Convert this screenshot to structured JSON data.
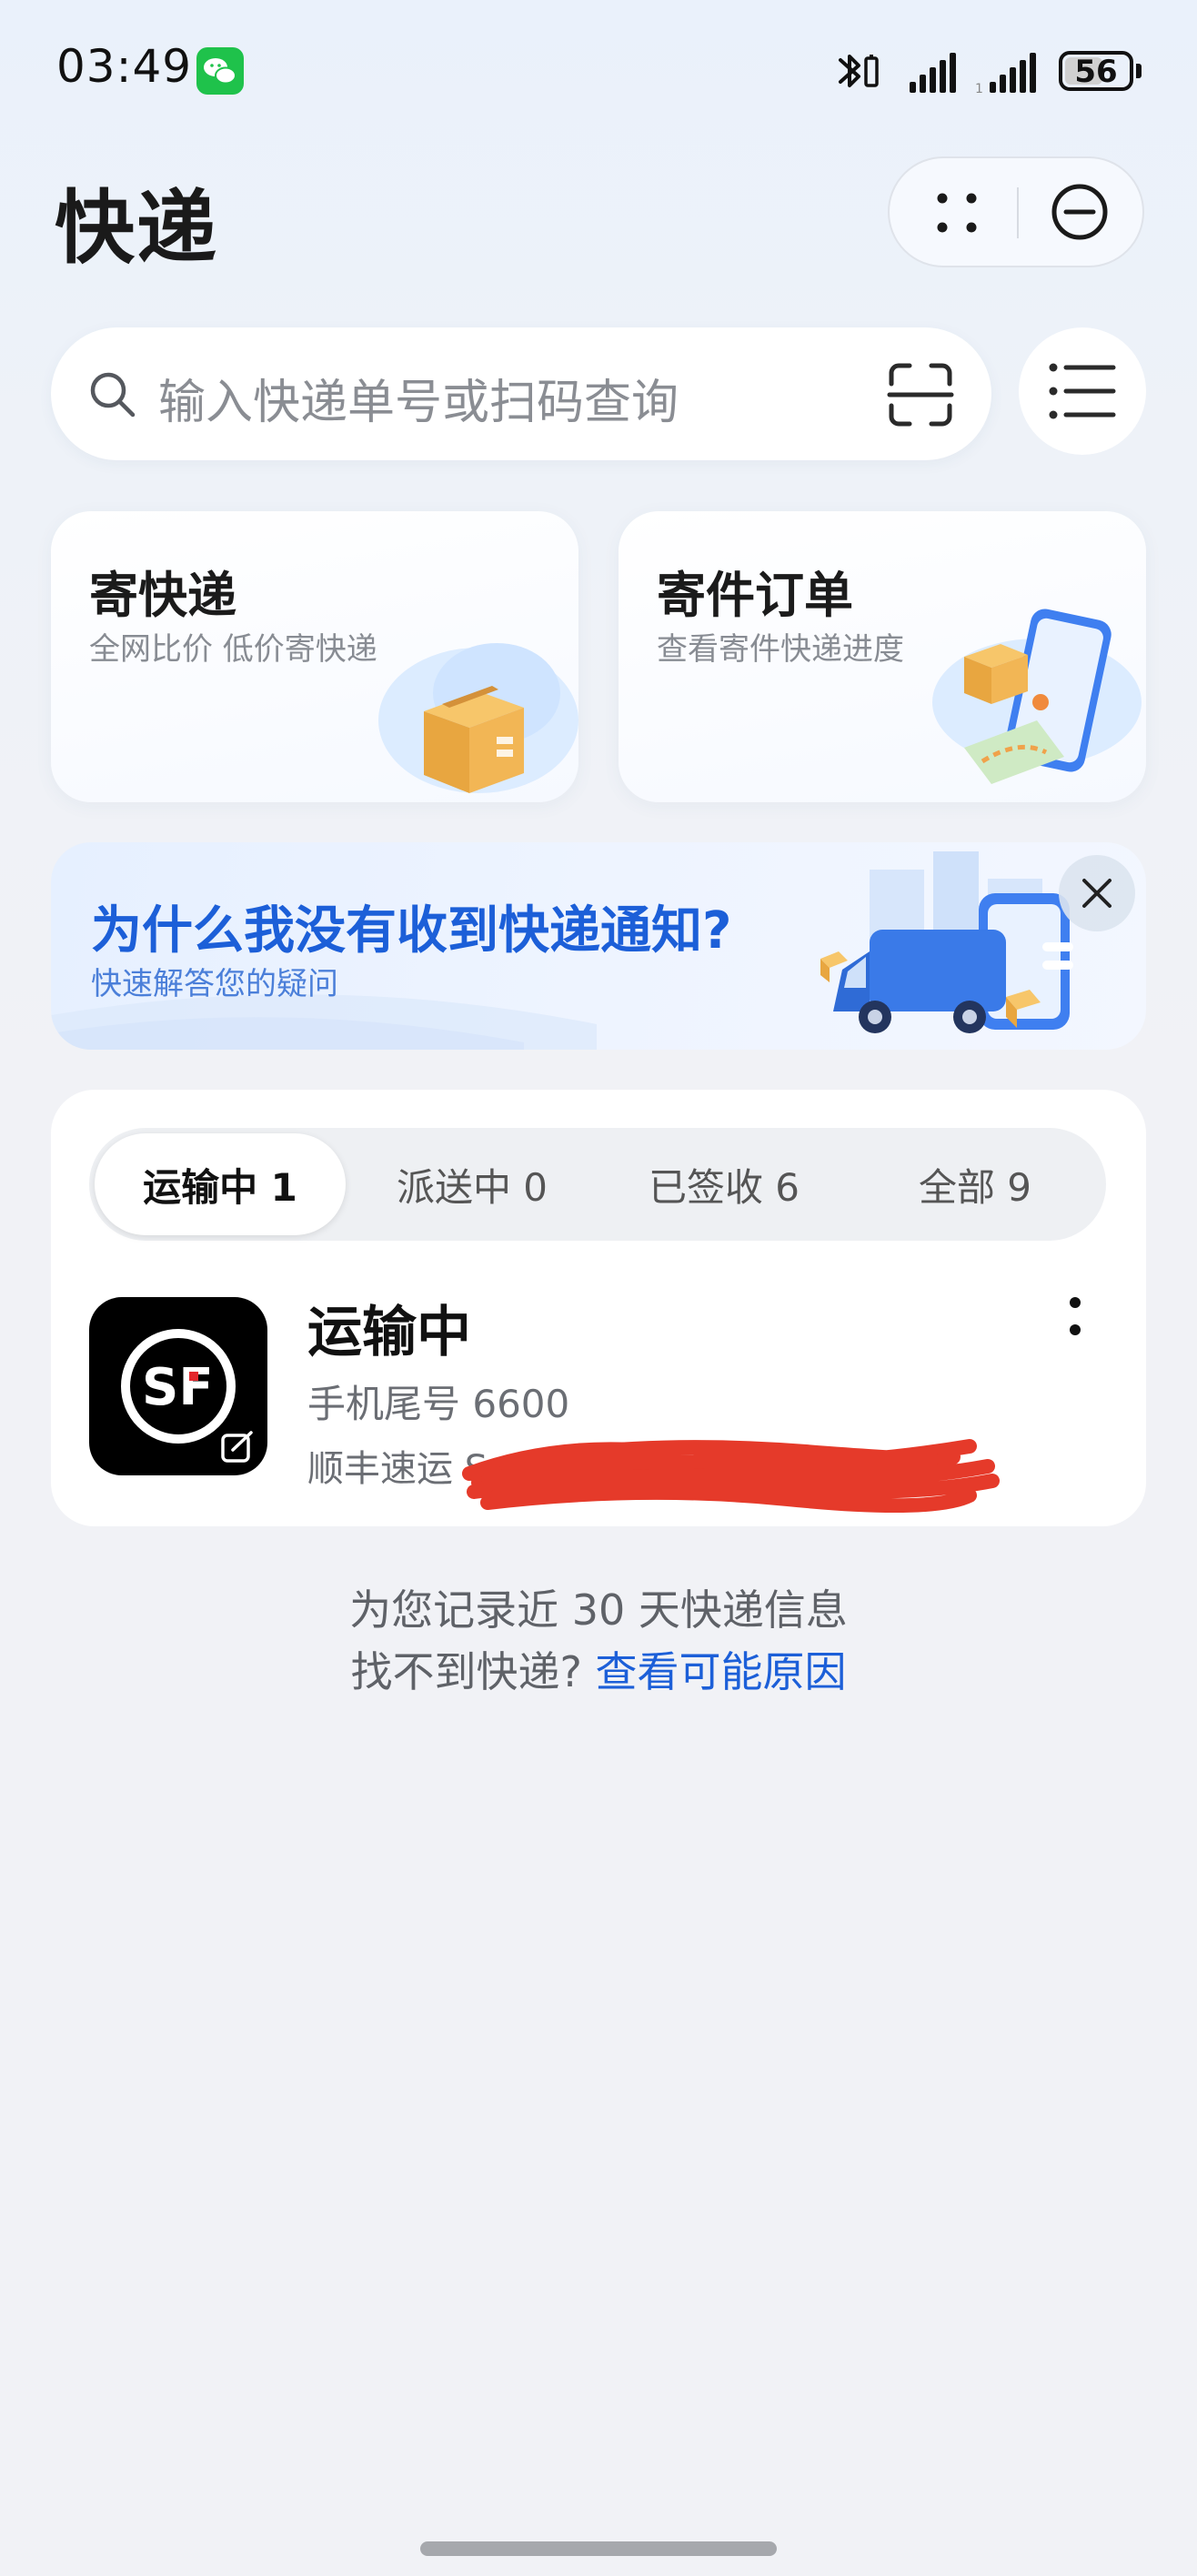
{
  "status_bar": {
    "time": "03:49",
    "notification_icon": "wechat-icon",
    "bluetooth_icon": "bluetooth-icon",
    "battery_level": "56"
  },
  "header": {
    "title": "快递",
    "more_icon": "four-dots-icon",
    "close_icon": "minus-circle-icon"
  },
  "search": {
    "placeholder": "输入快递单号或扫码查询",
    "scan_icon": "scan-icon",
    "list_icon": "list-icon"
  },
  "cards": [
    {
      "title": "寄快递",
      "subtitle": "全网比价 低价寄快递",
      "icon": "parcel-box-icon"
    },
    {
      "title": "寄件订单",
      "subtitle": "查看寄件快递进度",
      "icon": "phone-map-icon"
    }
  ],
  "banner": {
    "title": "为什么我没有收到快递通知?",
    "subtitle": "快速解答您的疑问",
    "icon": "delivery-truck-icon",
    "close_icon": "close-icon"
  },
  "tabs": [
    {
      "label": "运输中 1",
      "active": true
    },
    {
      "label": "派送中 0",
      "active": false
    },
    {
      "label": "已签收 6",
      "active": false
    },
    {
      "label": "全部 9",
      "active": false
    }
  ],
  "parcel": {
    "status": "运输中",
    "phone": "手机尾号 6600",
    "carrier": "顺丰速运 S",
    "logo_icon": "sf-express-logo-icon",
    "more_icon": "vertical-dots-icon"
  },
  "footer": {
    "note": "为您记录近 30 天快递信息",
    "question": "找不到快递? ",
    "link": "查看可能原因"
  },
  "colors": {
    "accent_blue": "#1c5fd8",
    "wechat_green": "#1fc24b",
    "redaction_red": "#e53a2a"
  }
}
